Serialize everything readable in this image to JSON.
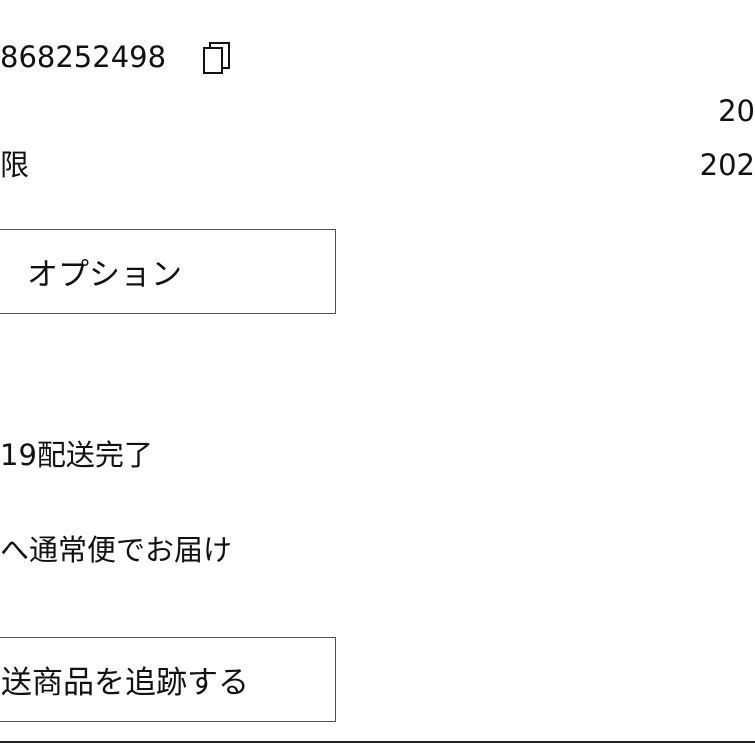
{
  "order": {
    "number": "868252498",
    "copy_icon": "copy-icon"
  },
  "details": {
    "date_value_1": "20",
    "label_2": "限",
    "date_value_2": "202"
  },
  "buttons": {
    "options_label": "オプション",
    "track_label": "送商品を追跡する"
  },
  "delivery": {
    "status": "19配送完了",
    "method": "へ通常便でお届け"
  }
}
